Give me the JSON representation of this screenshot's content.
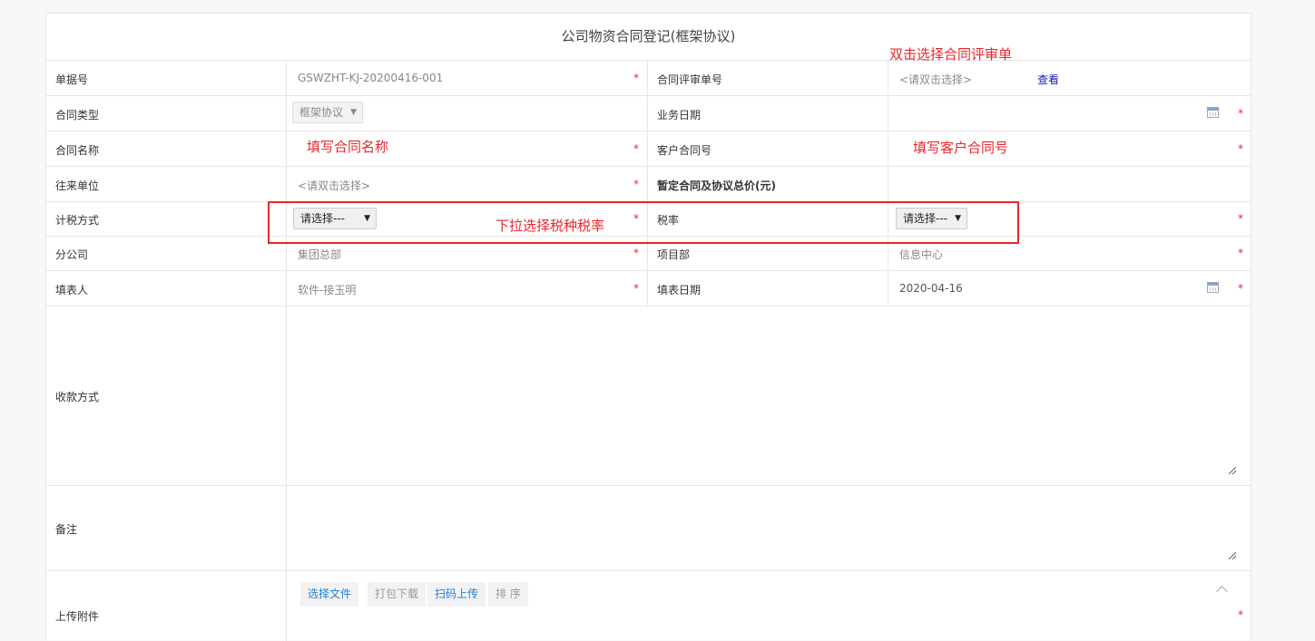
{
  "form": {
    "title": "公司物资合同登记(框架协议)",
    "required_mark": "*",
    "fields": {
      "doc_no": {
        "label": "单据号",
        "value": "GSWZHT-KJ-20200416-001"
      },
      "review_no": {
        "label": "合同评审单号",
        "placeholder": "<请双击选择>",
        "link": "查看"
      },
      "contract_type": {
        "label": "合同类型",
        "value": "框架协议"
      },
      "business_date": {
        "label": "业务日期",
        "value": ""
      },
      "contract_name": {
        "label": "合同名称",
        "value": ""
      },
      "customer_contract_no": {
        "label": "客户合同号",
        "value": ""
      },
      "counterparty": {
        "label": "往来单位",
        "placeholder": "<请双击选择>"
      },
      "total_price": {
        "label": "暂定合同及协议总价(元)",
        "value": ""
      },
      "tax_method": {
        "label": "计税方式",
        "value": "请选择---"
      },
      "tax_rate": {
        "label": "税率",
        "value": "请选择---"
      },
      "branch": {
        "label": "分公司",
        "value": "集团总部"
      },
      "project_dept": {
        "label": "项目部",
        "value": "信息中心"
      },
      "filler": {
        "label": "填表人",
        "value": "软件-接玉明"
      },
      "fill_date": {
        "label": "填表日期",
        "value": "2020-04-16"
      },
      "payment_method": {
        "label": "收款方式",
        "value": ""
      },
      "remarks": {
        "label": "备注",
        "value": ""
      },
      "attachments": {
        "label": "上传附件"
      }
    },
    "attachment_buttons": {
      "select_file": "选择文件",
      "pack_download": "打包下载",
      "scan_upload": "扫码上传",
      "sort": "排 序"
    }
  },
  "annotations": {
    "review_no_hint": "双击选择合同评审单",
    "contract_name_hint": "填写合同名称",
    "customer_no_hint": "填写客户合同号",
    "tax_hint": "下拉选择税种税率"
  },
  "colors": {
    "annotation": "#e8262b",
    "required": "#e8262b",
    "link": "#1a1ab8",
    "button_text_blue": "#1e7fd4"
  }
}
